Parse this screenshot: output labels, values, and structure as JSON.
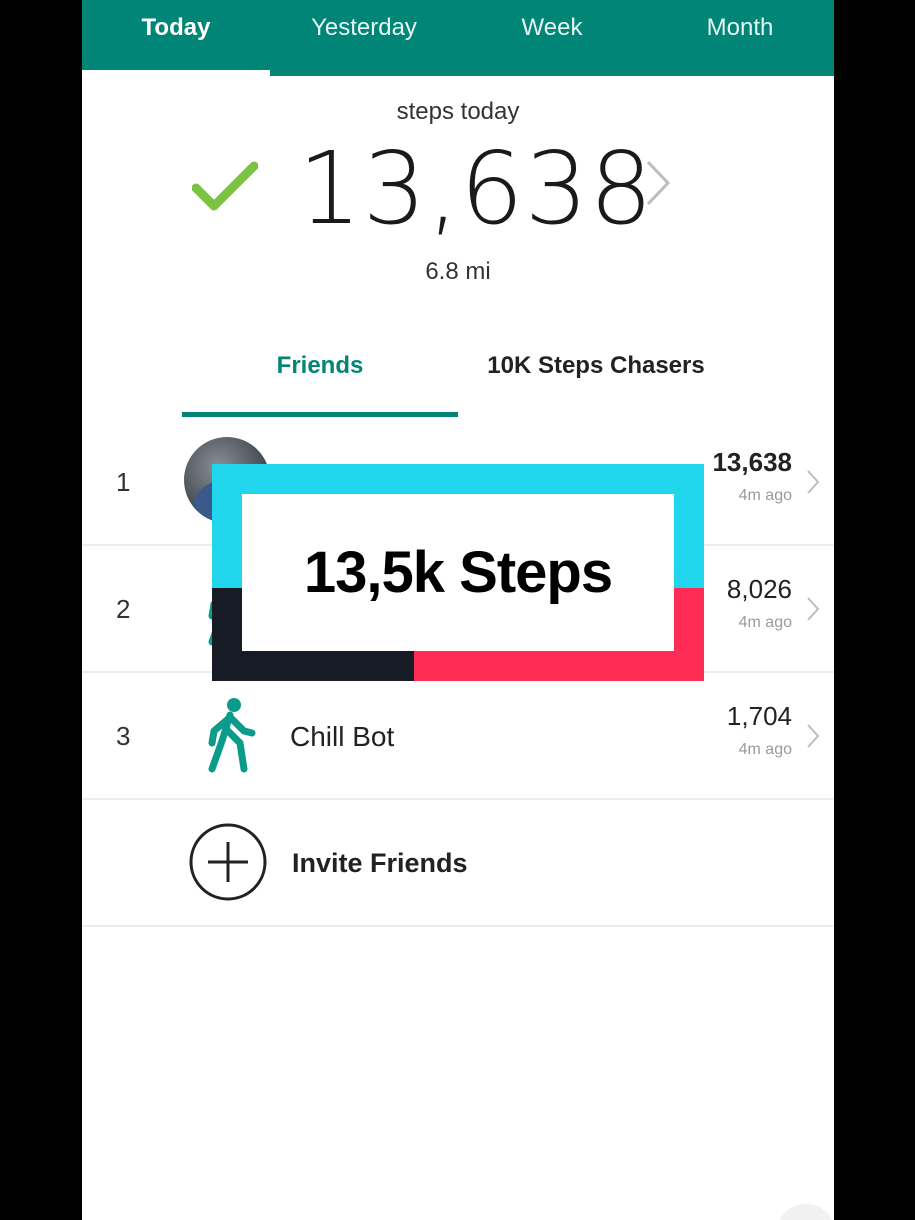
{
  "period_tabs": [
    "Today",
    "Yesterday",
    "Week",
    "Month"
  ],
  "summary": {
    "caption": "steps today",
    "steps": "13,638",
    "distance": "6.8 mi"
  },
  "leaderboard_tabs": [
    "Friends",
    "10K Steps Chasers"
  ],
  "rows": [
    {
      "rank": "1",
      "name": "",
      "count": "13,638",
      "ago": "4m ago"
    },
    {
      "rank": "2",
      "name": "",
      "count": "8,026",
      "ago": "4m ago"
    },
    {
      "rank": "3",
      "name": "Chill Bot",
      "count": "1,704",
      "ago": "4m ago"
    }
  ],
  "invite_label": "Invite Friends",
  "overlay_text": "13,5k Steps",
  "colors": {
    "brand_teal": "#008577",
    "check_green": "#7cc243",
    "overlay_cyan": "#20d5ec",
    "overlay_red": "#fe2c55",
    "overlay_dark": "#171b26"
  }
}
